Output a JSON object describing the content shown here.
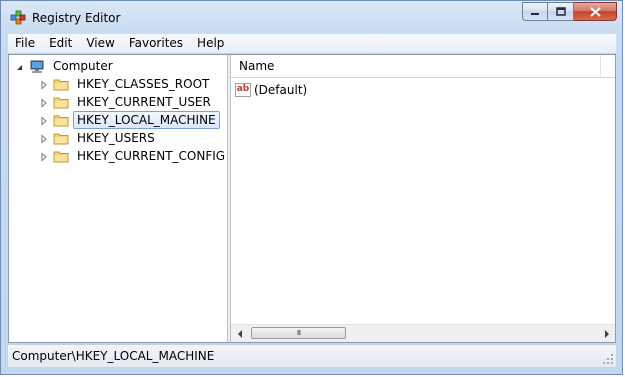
{
  "window": {
    "title": "Registry Editor"
  },
  "menu": [
    "File",
    "Edit",
    "View",
    "Favorites",
    "Help"
  ],
  "tree": {
    "root": "Computer",
    "hives": [
      {
        "label": "HKEY_CLASSES_ROOT",
        "selected": false
      },
      {
        "label": "HKEY_CURRENT_USER",
        "selected": false
      },
      {
        "label": "HKEY_LOCAL_MACHINE",
        "selected": true
      },
      {
        "label": "HKEY_USERS",
        "selected": false
      },
      {
        "label": "HKEY_CURRENT_CONFIG",
        "selected": false
      }
    ]
  },
  "list": {
    "columns": [
      "Name"
    ],
    "rows": [
      {
        "icon": "string-value-icon",
        "name": "(Default)"
      }
    ]
  },
  "scrollbar": {
    "grip_text": "III"
  },
  "status": {
    "path": "Computer\\HKEY_LOCAL_MACHINE"
  }
}
